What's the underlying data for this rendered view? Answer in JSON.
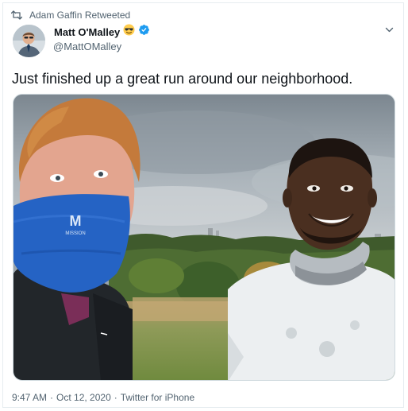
{
  "retweet": {
    "icon": "retweet-icon",
    "text": "Adam Gaffin Retweeted"
  },
  "author": {
    "name": "Matt O'Malley",
    "emoji": "smiling-face-with-sunglasses-icon",
    "verified_icon": "verified-badge-icon",
    "handle": "@MattOMalley"
  },
  "tweet": {
    "text": "Just finished up a great run around our neighborhood."
  },
  "media": {
    "gaiter_logo": "M",
    "gaiter_brand": "MISSION"
  },
  "meta": {
    "time": "9:47 AM",
    "separator": "·",
    "date": "Oct 12, 2020",
    "separator2": "·",
    "source": "Twitter for iPhone"
  },
  "colors": {
    "accent": "#1d9bf0",
    "secondary_text": "#536471",
    "primary_text": "#0f1419"
  }
}
